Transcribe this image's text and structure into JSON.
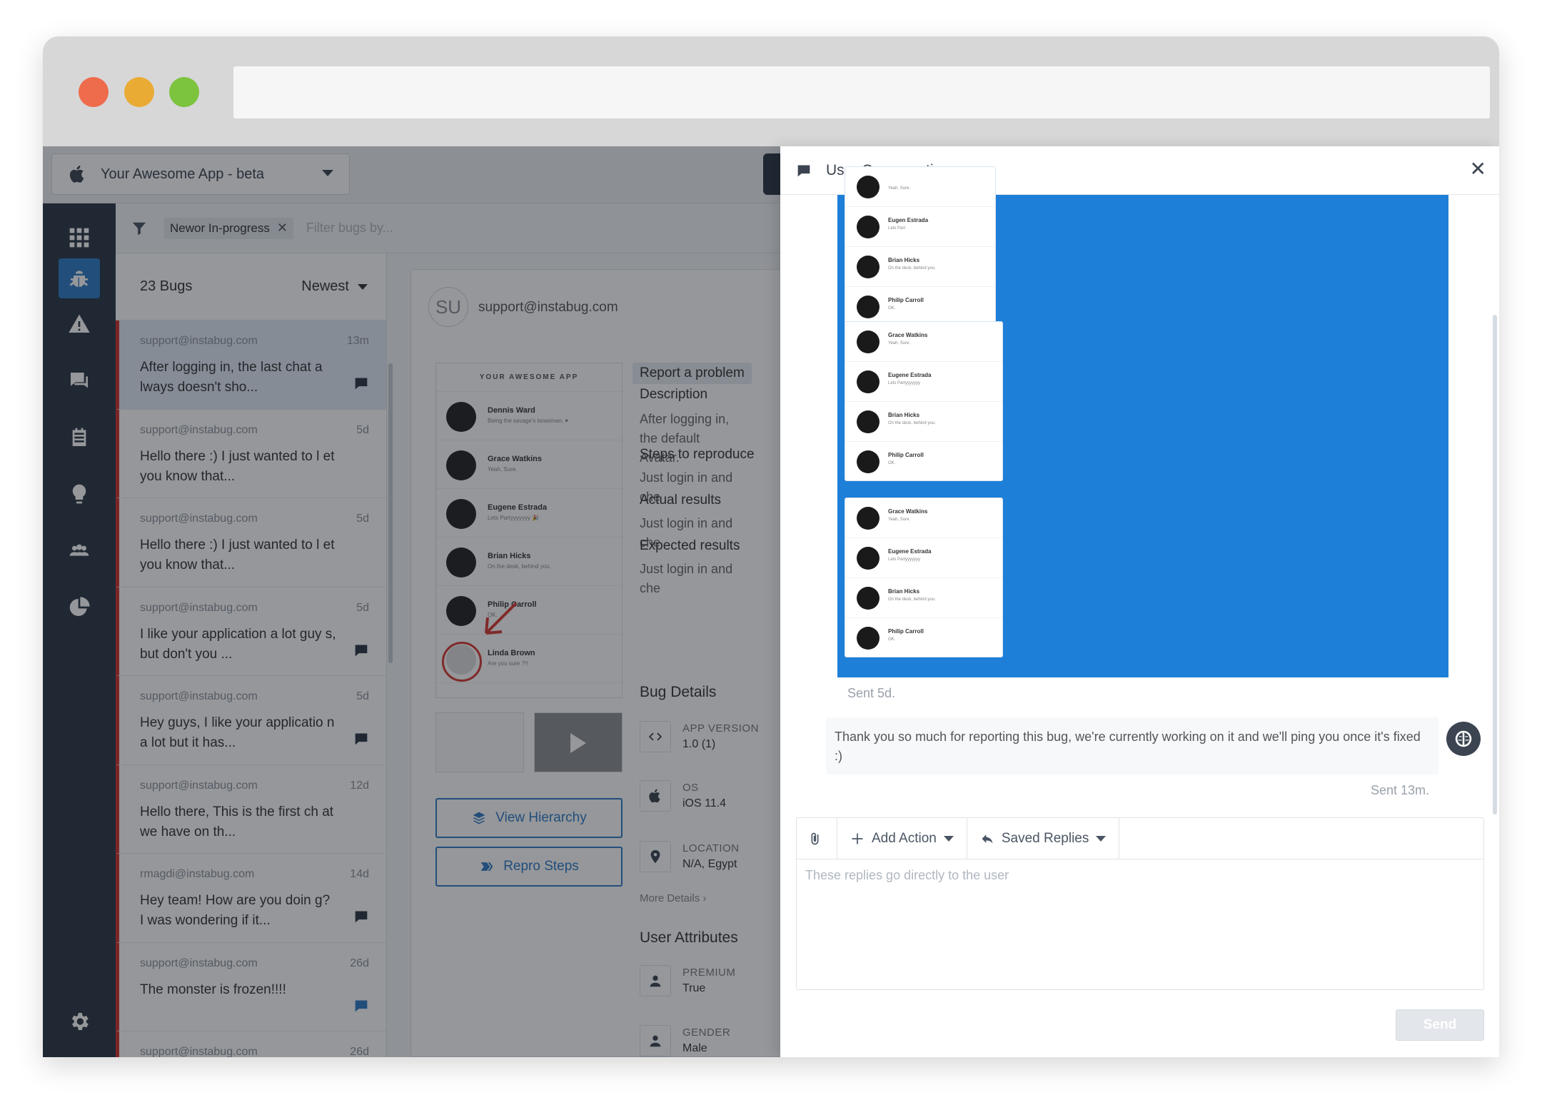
{
  "app_selector": {
    "name": "Your Awesome App - beta"
  },
  "filter": {
    "chip_strong": "New",
    "chip_rest": " or In-progress",
    "chip_close": "✕",
    "placeholder": "Filter bugs by..."
  },
  "list": {
    "count": "23 Bugs",
    "sort": "Newest",
    "bugs": [
      {
        "email": "support@instabug.com",
        "age": "13m",
        "text": "After logging in, the last chat a lways doesn't sho...",
        "has_message": true,
        "selected": true
      },
      {
        "email": "support@instabug.com",
        "age": "5d",
        "text": "Hello there :) I just wanted to l et you know that...",
        "has_message": false
      },
      {
        "email": "support@instabug.com",
        "age": "5d",
        "text": "Hello there :) I just wanted to l et you know that...",
        "has_message": false
      },
      {
        "email": "support@instabug.com",
        "age": "5d",
        "text": "I like your application a lot guy s, but don't you ...",
        "has_message": true
      },
      {
        "email": "support@instabug.com",
        "age": "5d",
        "text": "Hey guys, I like your applicatio n a lot but it has...",
        "has_message": true
      },
      {
        "email": "support@instabug.com",
        "age": "12d",
        "text": "Hello there, This is the first ch at we have on th...",
        "has_message": false
      },
      {
        "email": "rmagdi@instabug.com",
        "age": "14d",
        "text": "Hey team! How are you doin g? I was wondering if it...",
        "has_message": true
      },
      {
        "email": "support@instabug.com",
        "age": "26d",
        "text": "The monster is frozen!!!!",
        "has_message": true,
        "message_blue": true
      },
      {
        "email": "support@instabug.com",
        "age": "26d",
        "text": "",
        "has_message": false
      }
    ]
  },
  "detail": {
    "initials": "SU",
    "email": "support@instabug.com",
    "screenshot": {
      "header": "YOUR AWESOME APP",
      "rows": [
        {
          "name": "Dennis Ward",
          "sub": "Being the savage's bowsman, ♥"
        },
        {
          "name": "Grace Watkins",
          "sub": "Yeah, Sure."
        },
        {
          "name": "Eugene Estrada",
          "sub": "Lets Partyyyyyyy 🎉"
        },
        {
          "name": "Brian Hicks",
          "sub": "On the desk, behind you."
        },
        {
          "name": "Philip Carroll",
          "sub": "OK."
        },
        {
          "name": "Linda Brown",
          "sub": "Are you sure ?!!"
        }
      ]
    },
    "view_hierarchy": "View Hierarchy",
    "repro_steps": "Repro Steps",
    "category": "Report a problem",
    "sections": [
      {
        "heading": "Description",
        "text": "After logging in, the default Avatar."
      },
      {
        "heading": "Steps to reproduce",
        "text": "Just login in and che"
      },
      {
        "heading": "Actual results",
        "text": "Just login in and che"
      },
      {
        "heading": "Expected results",
        "text": "Just login in and che"
      }
    ],
    "bug_details_title": "Bug Details",
    "bug_details": [
      {
        "label": "APP VERSION",
        "value": "1.0 (1)",
        "icon": "code-icon"
      },
      {
        "label": "OS",
        "value": "iOS 11.4",
        "icon": "apple-icon"
      },
      {
        "label": "LOCATION",
        "value": "N/A, Egypt",
        "icon": "location-pin-icon"
      }
    ],
    "more_details": "More Details ›",
    "user_attributes_title": "User Attributes",
    "user_attributes": [
      {
        "label": "PREMIUM",
        "value": "True"
      },
      {
        "label": "GENDER",
        "value": "Male"
      }
    ]
  },
  "conversation": {
    "title": "User Conversation",
    "close": "✕",
    "image_cards": [
      {
        "rows": [
          {
            "name": "",
            "sub": "Yeah, Sure."
          },
          {
            "name": "Eugen  Estrada",
            "sub": "Lets Part"
          },
          {
            "name": "Brian Hicks",
            "sub": "On the desk, behind you."
          },
          {
            "name": "Philip Carroll",
            "sub": "OK."
          }
        ]
      },
      {
        "rows": [
          {
            "name": "Grace Watkins",
            "sub": "Yeah, Sure."
          },
          {
            "name": "Eugene Estrada",
            "sub": "Lets Partyyyyyyy"
          },
          {
            "name": "Brian Hicks",
            "sub": "On the desk, behind you."
          },
          {
            "name": "Philip Carroll",
            "sub": "OK."
          }
        ]
      },
      {
        "rows": [
          {
            "name": "Grace Watkins",
            "sub": "Yeah, Sure."
          },
          {
            "name": "Eugene Estrada",
            "sub": "Lets Partyyyyyyy"
          },
          {
            "name": "Brian Hicks",
            "sub": "On the desk, behind you."
          },
          {
            "name": "Philip Carroll",
            "sub": "OK."
          }
        ]
      }
    ],
    "sent_user": "Sent 5d.",
    "reply_text": "Thank you so much for reporting this bug, we're currently working on it and we'll ping you once it's fixed :)",
    "sent_agent": "Sent 13m.",
    "add_action": "Add Action",
    "saved_replies": "Saved Replies",
    "placeholder": "These replies go directly to the user",
    "send": "Send"
  },
  "colors": {
    "accent": "#2f7ac7",
    "bug_marker": "#d2312c",
    "sidebar": "#2a3544",
    "image_blue": "#1e7fd8"
  }
}
